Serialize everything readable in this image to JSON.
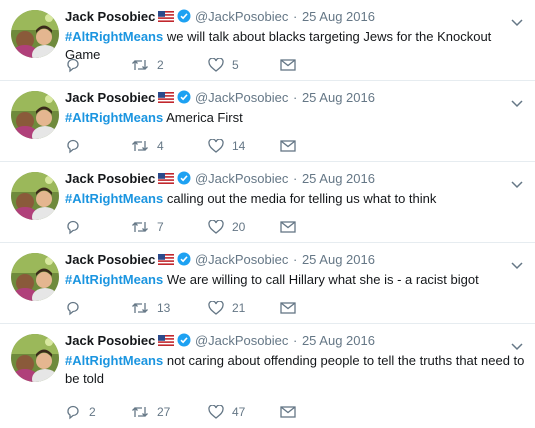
{
  "tweets": [
    {
      "name": "Jack Posobiec",
      "handle": "@JackPosobiec",
      "separator": "·",
      "date": "25 Aug 2016",
      "hashtag": "#AltRightMeans",
      "text": " we will talk about blacks targeting Jews for the Knockout Game",
      "replies": "",
      "retweets": "2",
      "likes": "5"
    },
    {
      "name": "Jack Posobiec",
      "handle": "@JackPosobiec",
      "separator": "·",
      "date": "25 Aug 2016",
      "hashtag": "#AltRightMeans",
      "text": " America First",
      "replies": "",
      "retweets": "4",
      "likes": "14"
    },
    {
      "name": "Jack Posobiec",
      "handle": "@JackPosobiec",
      "separator": "·",
      "date": "25 Aug 2016",
      "hashtag": "#AltRightMeans",
      "text": " calling out the media for telling us what to think",
      "replies": "",
      "retweets": "7",
      "likes": "20"
    },
    {
      "name": "Jack Posobiec",
      "handle": "@JackPosobiec",
      "separator": "·",
      "date": "25 Aug 2016",
      "hashtag": "#AltRightMeans",
      "text": " We are willing to call Hillary what she is - a racist bigot",
      "replies": "",
      "retweets": "13",
      "likes": "21"
    },
    {
      "name": "Jack Posobiec",
      "handle": "@JackPosobiec",
      "separator": "·",
      "date": "25 Aug 2016",
      "hashtag": "#AltRightMeans",
      "text": " not caring about offending people to tell the truths that need to be told",
      "replies": "2",
      "retweets": "27",
      "likes": "47"
    }
  ],
  "icons": {
    "flag": "us-flag-icon",
    "verified": "verified-badge-icon",
    "caret": "chevron-down-icon",
    "reply": "reply-icon",
    "retweet": "retweet-icon",
    "like": "heart-icon",
    "dm": "envelope-icon"
  },
  "colors": {
    "hashtag": "#1b95e0",
    "verified": "#1da1f2",
    "muted": "#657786",
    "divider": "#e6ecf0"
  }
}
